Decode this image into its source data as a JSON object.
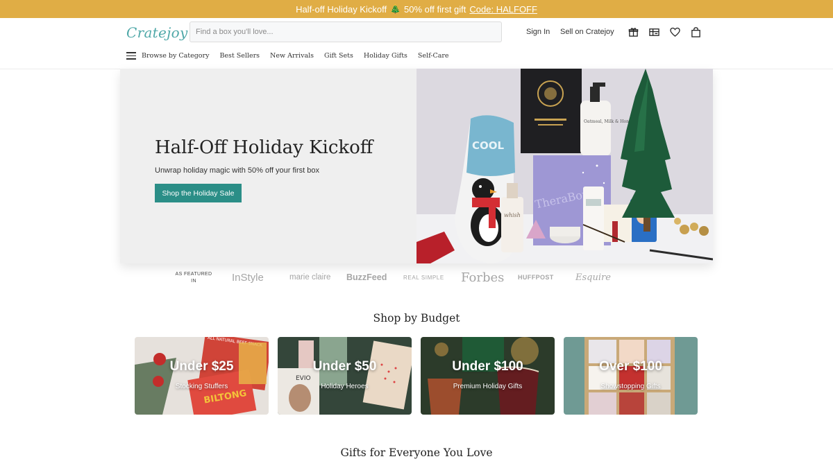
{
  "promo": {
    "text": "Half-off Holiday Kickoff",
    "tree": "🎄",
    "offer": "50% off first gift",
    "code_label": "Code: HALFOFF",
    "color": "#e0ad45"
  },
  "header": {
    "logo": "Cratejoy",
    "search_placeholder": "Find a box you'll love...",
    "signin": "Sign In",
    "sell": "Sell on Cratejoy",
    "icons": [
      "gift-icon",
      "gift-card-icon",
      "heart-icon",
      "bag-icon"
    ]
  },
  "nav": {
    "items": [
      {
        "label": "Browse by Category"
      },
      {
        "label": "Best Sellers"
      },
      {
        "label": "New Arrivals"
      },
      {
        "label": "Gift Sets"
      },
      {
        "label": "Holiday Gifts"
      },
      {
        "label": "Self-Care"
      }
    ]
  },
  "hero": {
    "title": "Half-Off Holiday Kickoff",
    "subtitle": "Unwrap holiday magic with 50% off your first box",
    "cta": "Shop the Holiday Sale",
    "cta_color": "#2b8e87",
    "image_texts": {
      "sock": "COOL",
      "lotion": "Oatmeal, Milk & Honey",
      "bath": "whish",
      "box": "TheraBox"
    }
  },
  "featured": {
    "label_line1": "AS FEATURED",
    "label_line2": "IN",
    "brands": [
      "InStyle",
      "marie claire",
      "BuzzFeed",
      "REAL SIMPLE",
      "Forbes",
      "HUFFPOST",
      "Esquire"
    ]
  },
  "budget": {
    "title": "Shop by Budget",
    "cards": [
      {
        "title": "Under $25",
        "subtitle": "Stocking Stuffers",
        "image_text_1": "BILTONG",
        "image_text_2": "ALL NATURAL BEEF SNACK"
      },
      {
        "title": "Under $50",
        "subtitle": "Holiday Heroes",
        "image_text_1": "EVIO"
      },
      {
        "title": "Under $100",
        "subtitle": "Premium Holiday Gifts"
      },
      {
        "title": "Over $100",
        "subtitle": "Showstopping Gifts"
      }
    ]
  },
  "everyone": {
    "title": "Gifts for Everyone You Love"
  }
}
